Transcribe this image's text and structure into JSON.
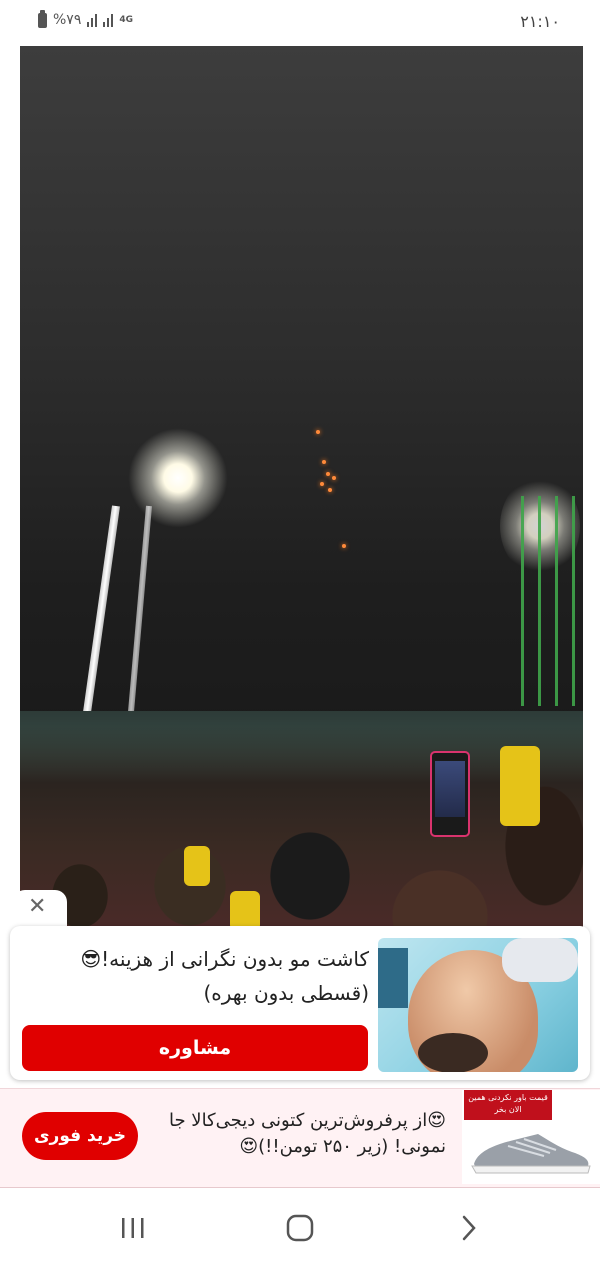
{
  "status_bar": {
    "battery": "%۷۹",
    "network": "4G",
    "time": "۲۱:۱۰"
  },
  "ad": {
    "title": "کاشت مو بدون نگرانی از هزینه!😎 (قسطی بدون بهره)",
    "cta": "مشاوره"
  },
  "banner": {
    "text": "😍از پرفروش‌ترین کتونی دیجی‌کالا جا نمونی! (زیر ۲۵۰ تومن!!)😍",
    "button": "خرید فوری",
    "tag": "قیمت باور نکردنی همین الان بخر"
  },
  "icons": {
    "close": "close-icon",
    "recent": "recent-apps-icon",
    "home": "home-icon",
    "back": "back-icon"
  },
  "colors": {
    "cta_red": "#e00000",
    "banner_bg": "#fff2f4"
  }
}
